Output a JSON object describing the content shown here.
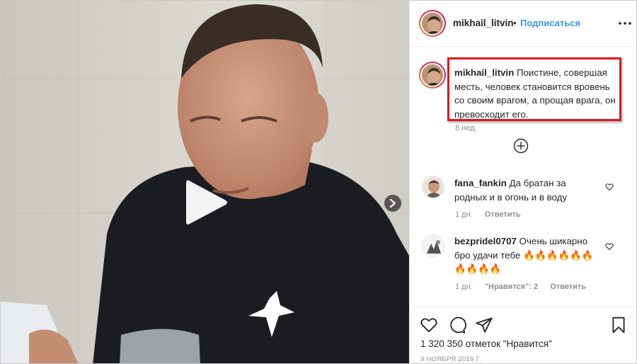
{
  "header": {
    "username": "mikhail_litvin",
    "dot": "•",
    "follow": "Подписаться"
  },
  "caption": {
    "username": "mikhail_litvin",
    "text": "Поистине, совершая месть, человек становится вровень со своим врагом, а прощая врага, он превосходит его.",
    "time": "8 нед."
  },
  "comments": [
    {
      "username": "fana_fankin",
      "text": "Да братан за родных и в огонь и в воду",
      "time": "1 дн.",
      "reply": "Ответить"
    },
    {
      "username": "bezpridel0707",
      "text": "Очень шикарно бро удачи тебе 🔥🔥🔥🔥🔥🔥🔥🔥🔥🔥",
      "time": "1 дн.",
      "likes": "\"Нравится\": 2",
      "reply": "Ответить"
    }
  ],
  "footer": {
    "likes": "1 320 350 отметок \"Нравится\"",
    "date": "9 НОЯБРЯ 2019 Г."
  },
  "icons": {
    "play": "play-icon",
    "next": "chevron-right-icon",
    "more": "more-horizontal-icon",
    "load_more": "plus-circle-icon",
    "heart": "heart-icon",
    "comment": "comment-icon",
    "share": "send-icon",
    "save": "bookmark-icon"
  },
  "colors": {
    "link": "#3897f0",
    "highlight": "#e3161b",
    "meta": "#8e8e8e"
  }
}
